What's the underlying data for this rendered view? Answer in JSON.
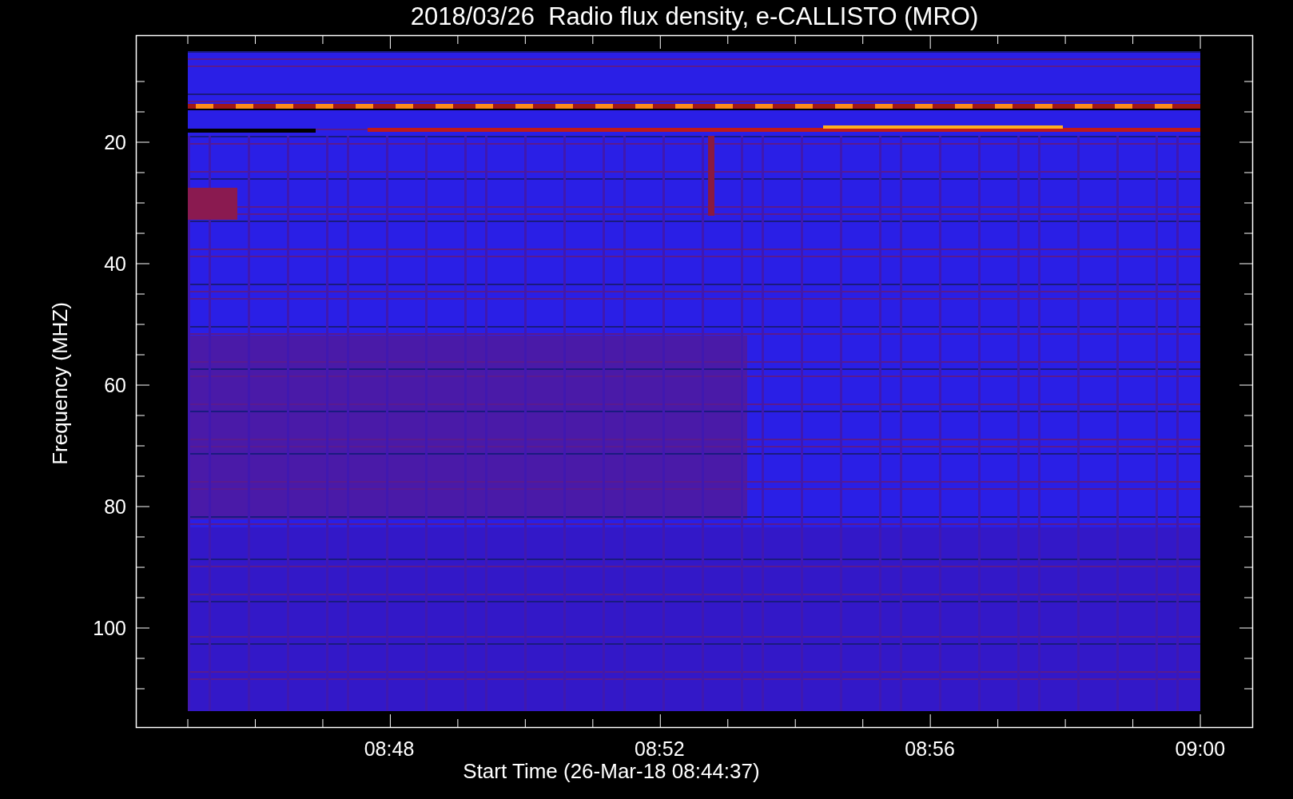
{
  "title": "2018/03/26  Radio flux density, e-CALLISTO (MRO)",
  "y_axis": {
    "label": "Frequency (MHZ)",
    "ticks": [
      "20",
      "40",
      "60",
      "80",
      "100"
    ]
  },
  "x_axis": {
    "label": "Start Time (26-Mar-18 08:44:37)",
    "ticks": [
      "08:48",
      "08:52",
      "08:56",
      "09:00"
    ]
  }
}
